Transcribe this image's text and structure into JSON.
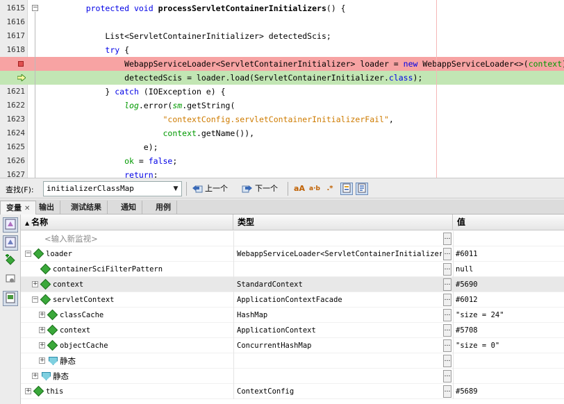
{
  "editor": {
    "lines": [
      {
        "num": "1615",
        "segments": [
          {
            "t": "    ",
            "c": ""
          },
          {
            "t": "protected void ",
            "c": "kw"
          },
          {
            "t": "processServletContainerInitializers",
            "c": "fn"
          },
          {
            "t": "() {",
            "c": ""
          }
        ],
        "hl": "",
        "fold": "minus"
      },
      {
        "num": "1616",
        "segments": [],
        "hl": ""
      },
      {
        "num": "1617",
        "segments": [
          {
            "t": "        List<ServletContainerInitializer> detectedScis;",
            "c": ""
          }
        ],
        "hl": ""
      },
      {
        "num": "1618",
        "segments": [
          {
            "t": "        ",
            "c": ""
          },
          {
            "t": "try",
            "c": "kw"
          },
          {
            "t": " {",
            "c": ""
          }
        ],
        "hl": ""
      },
      {
        "num": "",
        "segments": [
          {
            "t": "            WebappServiceLoader<ServletContainerInitializer> loader = ",
            "c": ""
          },
          {
            "t": "new",
            "c": "kw"
          },
          {
            "t": " WebappServiceLoader<>(",
            "c": ""
          },
          {
            "t": "context",
            "c": "ctx"
          },
          {
            "t": ");",
            "c": ""
          }
        ],
        "hl": "red",
        "marker": "breakpoint"
      },
      {
        "num": "",
        "segments": [
          {
            "t": "            detectedScis = loader.load(ServletContainerInitializer.",
            "c": ""
          },
          {
            "t": "class",
            "c": "kw"
          },
          {
            "t": ");",
            "c": ""
          }
        ],
        "hl": "green",
        "marker": "arrow"
      },
      {
        "num": "1621",
        "segments": [
          {
            "t": "        } ",
            "c": ""
          },
          {
            "t": "catch",
            "c": "kw"
          },
          {
            "t": " (IOException e) {",
            "c": ""
          }
        ],
        "hl": ""
      },
      {
        "num": "1622",
        "segments": [
          {
            "t": "            ",
            "c": ""
          },
          {
            "t": "log",
            "c": "it fld"
          },
          {
            "t": ".error(",
            "c": ""
          },
          {
            "t": "sm",
            "c": "it fld"
          },
          {
            "t": ".getString(",
            "c": ""
          }
        ],
        "hl": ""
      },
      {
        "num": "1623",
        "segments": [
          {
            "t": "                    ",
            "c": ""
          },
          {
            "t": "\"contextConfig.servletContainerInitializerFail\"",
            "c": "str"
          },
          {
            "t": ",",
            "c": ""
          }
        ],
        "hl": ""
      },
      {
        "num": "1624",
        "segments": [
          {
            "t": "                    ",
            "c": ""
          },
          {
            "t": "context",
            "c": "ctx"
          },
          {
            "t": ".getName()),",
            "c": ""
          }
        ],
        "hl": ""
      },
      {
        "num": "1625",
        "segments": [
          {
            "t": "                e);",
            "c": ""
          }
        ],
        "hl": ""
      },
      {
        "num": "1626",
        "segments": [
          {
            "t": "            ",
            "c": ""
          },
          {
            "t": "ok",
            "c": "ctx"
          },
          {
            "t": " = ",
            "c": ""
          },
          {
            "t": "false",
            "c": "kw"
          },
          {
            "t": ";",
            "c": ""
          }
        ],
        "hl": ""
      },
      {
        "num": "1627",
        "segments": [
          {
            "t": "            ",
            "c": ""
          },
          {
            "t": "return",
            "c": "kw"
          },
          {
            "t": ";",
            "c": ""
          }
        ],
        "hl": ""
      }
    ]
  },
  "findbar": {
    "label": "查找(F):",
    "query": "initializerClassMap",
    "prev_label": "上一个",
    "next_label": "下一个"
  },
  "panel": {
    "tabs": [
      {
        "label": "变量",
        "active": true
      },
      {
        "label": "输出"
      },
      {
        "label": "测试结果"
      },
      {
        "label": "通知"
      },
      {
        "label": "用例"
      }
    ],
    "columns": {
      "name": "名称",
      "type": "类型",
      "value": "值"
    },
    "placeholder": "<输入新监视>",
    "rows": [
      {
        "depth": 0,
        "expander": "minus",
        "icon": "var",
        "name": "loader",
        "type": "WebappServiceLoader<ServletContainerInitializer>",
        "value": "#6011"
      },
      {
        "depth": 1,
        "expander": "",
        "icon": "var",
        "name": "containerSciFilterPattern",
        "type": "",
        "value": "null"
      },
      {
        "depth": 1,
        "expander": "plus",
        "icon": "var",
        "name": "context",
        "type": "StandardContext",
        "value": "#5690",
        "selected": true
      },
      {
        "depth": 1,
        "expander": "minus",
        "icon": "var",
        "name": "servletContext",
        "type": "ApplicationContextFacade",
        "value": "#6012"
      },
      {
        "depth": 2,
        "expander": "plus",
        "icon": "var",
        "name": "classCache",
        "type": "HashMap",
        "value": "\"size = 24\""
      },
      {
        "depth": 2,
        "expander": "plus",
        "icon": "var",
        "name": "context",
        "type": "ApplicationContext",
        "value": "#5708"
      },
      {
        "depth": 2,
        "expander": "plus",
        "icon": "var",
        "name": "objectCache",
        "type": "ConcurrentHashMap",
        "value": "\"size = 0\""
      },
      {
        "depth": 2,
        "expander": "plus",
        "icon": "static",
        "name": "静态",
        "type": "",
        "value": ""
      },
      {
        "depth": 1,
        "expander": "plus",
        "icon": "static",
        "name": "静态",
        "type": "",
        "value": ""
      },
      {
        "depth": 0,
        "expander": "plus",
        "icon": "var",
        "name": "this",
        "type": "ContextConfig",
        "value": "#5689"
      }
    ]
  },
  "colors": {
    "keyword": "#0000e6",
    "breakpoint_line": "#f7a3a3",
    "current_line": "#c2e6b4",
    "string": "#ce7b00",
    "field": "#009900"
  }
}
